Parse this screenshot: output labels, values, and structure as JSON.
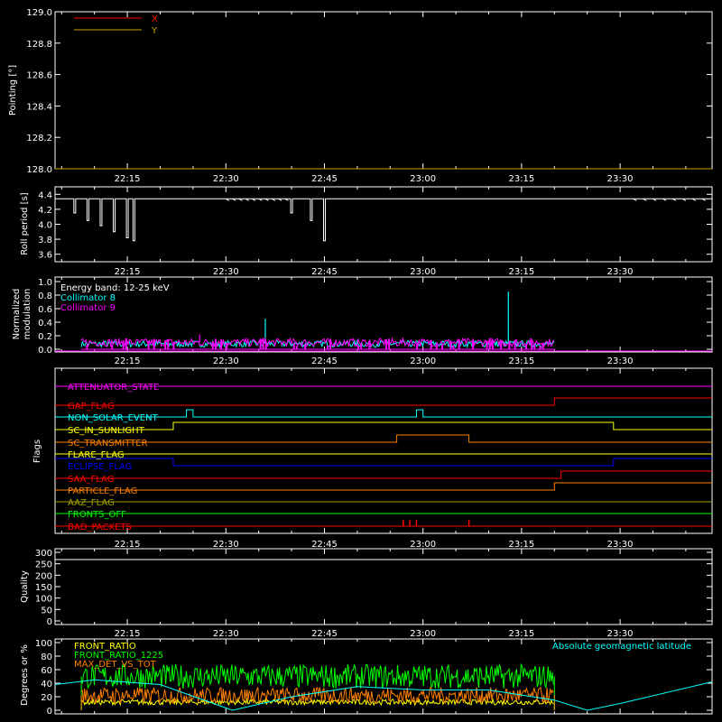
{
  "time_ticks": [
    "22:15",
    "22:30",
    "22:45",
    "23:00",
    "23:15",
    "23:30"
  ],
  "panels": {
    "pointing": {
      "ylabel": "Pointing [°]",
      "yticks": [
        "128.0",
        "128.2",
        "128.4",
        "128.6",
        "128.8",
        "129.0"
      ],
      "legend": [
        {
          "label": "X",
          "color": "#ff0000"
        },
        {
          "label": "Y",
          "color": "#c8a000"
        }
      ]
    },
    "roll": {
      "ylabel": "Roll period [s]",
      "yticks": [
        "3.6",
        "3.8",
        "4.0",
        "4.2",
        "4.4"
      ]
    },
    "modulation": {
      "ylabel_line1": "Normalized",
      "ylabel_line2": "modulation",
      "yticks": [
        "0.0",
        "0.2",
        "0.4",
        "0.6",
        "0.8",
        "1.0"
      ],
      "legend": [
        {
          "label": "Energy band: 12-25 keV",
          "color": "#ffffff"
        },
        {
          "label": "Collimator 8",
          "color": "#00ffff"
        },
        {
          "label": "Collimator 9",
          "color": "#ff00ff"
        }
      ]
    },
    "flags": {
      "ylabel": "Flags",
      "rows": [
        {
          "label": "ATTENUATOR_STATE",
          "color": "#ff00ff"
        },
        {
          "label": "GAP_FLAG",
          "color": "#ff0000"
        },
        {
          "label": "NON_SOLAR_EVENT",
          "color": "#00ffff"
        },
        {
          "label": "SC_IN_SUNLIGHT",
          "color": "#ffff00"
        },
        {
          "label": "SC_TRANSMITTER",
          "color": "#ff8000"
        },
        {
          "label": "FLARE_FLAG",
          "color": "#ffff00"
        },
        {
          "label": "ECLIPSE_FLAG",
          "color": "#0000ff"
        },
        {
          "label": "SAA_FLAG",
          "color": "#ff0000"
        },
        {
          "label": "PARTICLE_FLAG",
          "color": "#ff8000"
        },
        {
          "label": "AAZ_FLAG",
          "color": "#a0a000"
        },
        {
          "label": "FRONTS_OFF",
          "color": "#00ff00"
        },
        {
          "label": "BAD_PACKETS",
          "color": "#ff0000"
        }
      ]
    },
    "quality": {
      "ylabel": "Quality",
      "yticks": [
        "0",
        "50",
        "100",
        "150",
        "200",
        "250",
        "300"
      ]
    },
    "ratios": {
      "ylabel": "Degrees or %",
      "yticks": [
        "0",
        "20",
        "40",
        "60",
        "80",
        "100"
      ],
      "legend": [
        {
          "label": "FRONT_RATIO",
          "color": "#ffff00"
        },
        {
          "label": "FRONT_RATIO_1225",
          "color": "#00ff00"
        },
        {
          "label": "MAX_DET_VS_TOT",
          "color": "#ff8000"
        }
      ],
      "right_label": {
        "label": "Absolute geomagnetic latitude",
        "color": "#00ffff"
      }
    }
  },
  "chart_data": [
    {
      "type": "line",
      "title": "",
      "ylabel": "Pointing [°]",
      "ylim": [
        128.0,
        129.0
      ],
      "x_range": [
        "22:04",
        "23:44"
      ],
      "series": [
        {
          "name": "X",
          "color": "#ff0000",
          "x": [
            "22:04",
            "23:44"
          ],
          "values": [
            128.0,
            128.0
          ]
        },
        {
          "name": "Y",
          "color": "#c8a000",
          "x": [
            "22:04",
            "23:44"
          ],
          "values": [
            128.0,
            128.0
          ]
        }
      ]
    },
    {
      "type": "line",
      "ylabel": "Roll period [s]",
      "ylim": [
        3.5,
        4.5
      ],
      "baseline": 4.34,
      "dips": [
        {
          "t": "22:07",
          "v": 4.15
        },
        {
          "t": "22:09",
          "v": 4.05
        },
        {
          "t": "22:11",
          "v": 3.98
        },
        {
          "t": "22:13",
          "v": 3.9
        },
        {
          "t": "22:15",
          "v": 3.82
        },
        {
          "t": "22:16",
          "v": 3.78
        },
        {
          "t": "22:40",
          "v": 4.15
        },
        {
          "t": "22:43",
          "v": 4.05
        },
        {
          "t": "22:45",
          "v": 3.78
        }
      ]
    },
    {
      "type": "line",
      "ylabel": "Normalized modulation",
      "ylim": [
        0.0,
        1.0
      ],
      "data_span": [
        "22:08",
        "23:20"
      ],
      "series": [
        {
          "name": "Collimator 8",
          "color": "#00ffff",
          "typical": 0.08,
          "peaks": [
            {
              "t": "22:36",
              "v": 0.45
            },
            {
              "t": "23:13",
              "v": 0.85
            }
          ]
        },
        {
          "name": "Collimator 9",
          "color": "#ff00ff",
          "typical": 0.1,
          "peaks": [
            {
              "t": "22:26",
              "v": 0.22
            }
          ]
        }
      ]
    },
    {
      "type": "line",
      "ylabel": "Quality",
      "ylim": [
        0,
        300
      ],
      "series": [
        {
          "name": "Quality",
          "color": "#ffffff",
          "values": [
            0
          ]
        }
      ]
    },
    {
      "type": "line",
      "ylabel": "Degrees or %",
      "ylim": [
        0,
        100
      ],
      "data_span": [
        "22:08",
        "23:20"
      ],
      "series": [
        {
          "name": "FRONT_RATIO",
          "color": "#ffff00",
          "typical": 12
        },
        {
          "name": "FRONT_RATIO_1225",
          "color": "#00ff00",
          "typical": 50
        },
        {
          "name": "MAX_DET_VS_TOT",
          "color": "#ff8000",
          "typical": 22
        },
        {
          "name": "Absolute geomagnetic latitude",
          "color": "#00ffff",
          "x": [
            "22:00",
            "22:10",
            "22:20",
            "22:31",
            "22:40",
            "22:50",
            "23:00",
            "23:10",
            "23:20",
            "23:25",
            "23:30",
            "23:44"
          ],
          "values": [
            38,
            45,
            38,
            0,
            20,
            35,
            30,
            30,
            15,
            0,
            10,
            42
          ]
        }
      ]
    }
  ]
}
